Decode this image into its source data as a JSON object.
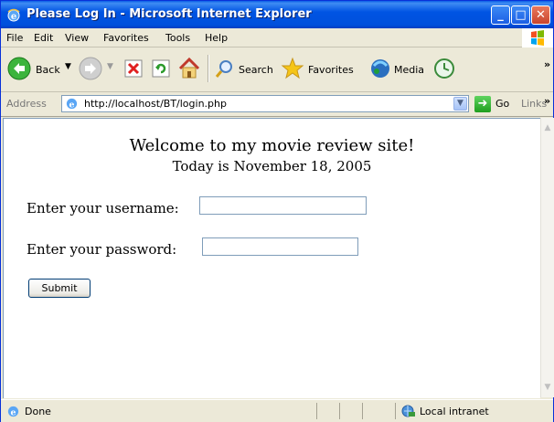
{
  "window": {
    "title": "Please Log In - Microsoft Internet Explorer",
    "controls": {
      "minimize": "_",
      "maximize": "□",
      "close": "✕"
    }
  },
  "menu": {
    "file": "File",
    "edit": "Edit",
    "view": "View",
    "favorites": "Favorites",
    "tools": "Tools",
    "help": "Help"
  },
  "toolbar": {
    "back": "Back",
    "search": "Search",
    "favorites": "Favorites",
    "media": "Media",
    "overflow": "»"
  },
  "address": {
    "label": "Address",
    "url": "http://localhost/BT/login.php",
    "go": "Go",
    "links": "Links",
    "links_overflow": "»"
  },
  "page": {
    "heading": "Welcome to my movie review site!",
    "date_line": "Today is November 18, 2005",
    "username_label": "Enter your username:",
    "username_value": "",
    "password_label": "Enter your password:",
    "password_value": "",
    "submit_label": "Submit"
  },
  "status": {
    "text": "Done",
    "zone": "Local intranet"
  },
  "colors": {
    "title_bar": "#0054e3",
    "chrome": "#ece9d8",
    "input_border": "#7f9db9"
  }
}
